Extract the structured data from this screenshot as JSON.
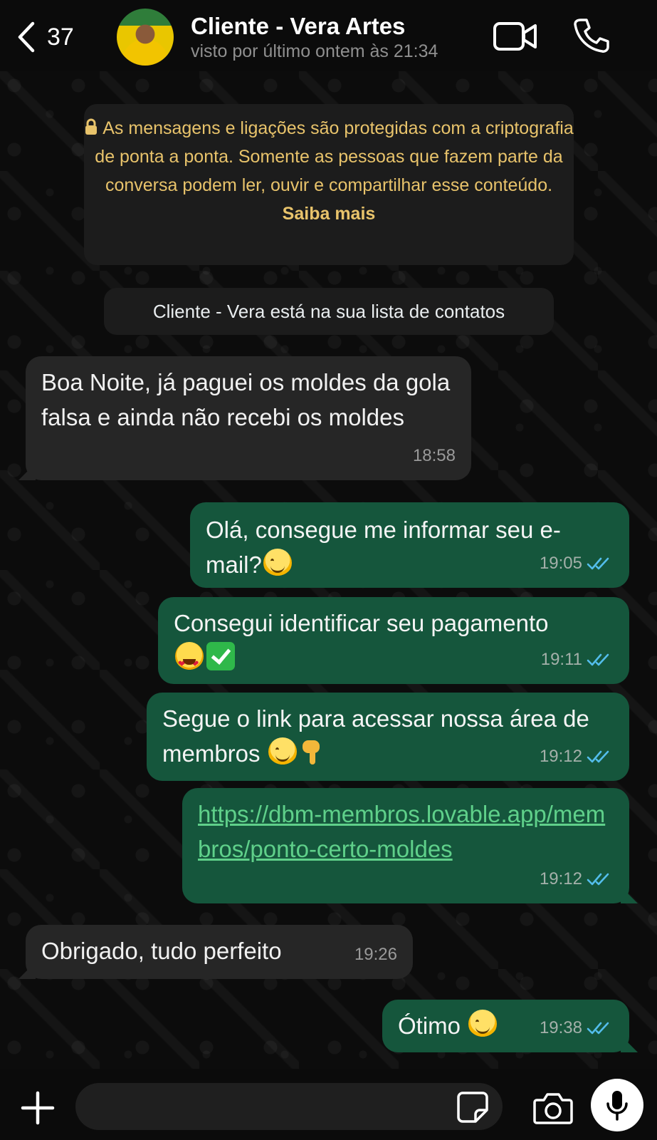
{
  "header": {
    "back_count": "37",
    "contact_name": "Cliente - Vera Artes",
    "last_seen": "visto por último ontem às 21:34"
  },
  "notices": {
    "encryption": "As mensagens e ligações são protegidas com a criptografia de ponta a ponta. Somente as pessoas que fazem parte da conversa podem ler, ouvir e compartilhar esse conteúdo.",
    "learn_more": "Saiba mais",
    "contact_list": "Cliente - Vera está na sua lista de contatos"
  },
  "messages": [
    {
      "direction": "in",
      "text": "Boa Noite, já paguei os moldes da gola falsa e ainda não recebi os moldes",
      "time": "18:58"
    },
    {
      "direction": "out",
      "text": "Olá, consegue me informar seu e-mail?",
      "emoji": [
        "smiling-face"
      ],
      "time": "19:05",
      "status": "read"
    },
    {
      "direction": "out",
      "text": "Consegui identificar seu pagamento",
      "emoji": [
        "heart-eyes-face",
        "check-mark-button"
      ],
      "time": "19:11",
      "status": "read"
    },
    {
      "direction": "out",
      "text": "Segue o link para acessar nossa área de membros",
      "emoji": [
        "smiling-face",
        "pointing-down"
      ],
      "time": "19:12",
      "status": "read"
    },
    {
      "direction": "out",
      "text": "https://dbm-membros.lovable.app/membros/ponto-certo-moldes",
      "is_link": true,
      "time": "19:12",
      "status": "read"
    },
    {
      "direction": "in",
      "text": "Obrigado, tudo perfeito",
      "time": "19:26"
    },
    {
      "direction": "out",
      "text": "Ótimo",
      "emoji": [
        "smiling-face"
      ],
      "time": "19:38",
      "status": "read"
    }
  ],
  "input": {
    "placeholder": ""
  },
  "colors": {
    "outgoing_bubble": "#15563c",
    "incoming_bubble": "#262626",
    "read_ticks": "#53bdeb",
    "notice_text": "#e8c36b",
    "link": "#5fd08a"
  },
  "icons": [
    "chevron-left-icon",
    "video-camera-icon",
    "phone-icon",
    "lock-icon",
    "double-check-icon",
    "plus-icon",
    "sticker-icon",
    "camera-icon",
    "microphone-icon"
  ]
}
